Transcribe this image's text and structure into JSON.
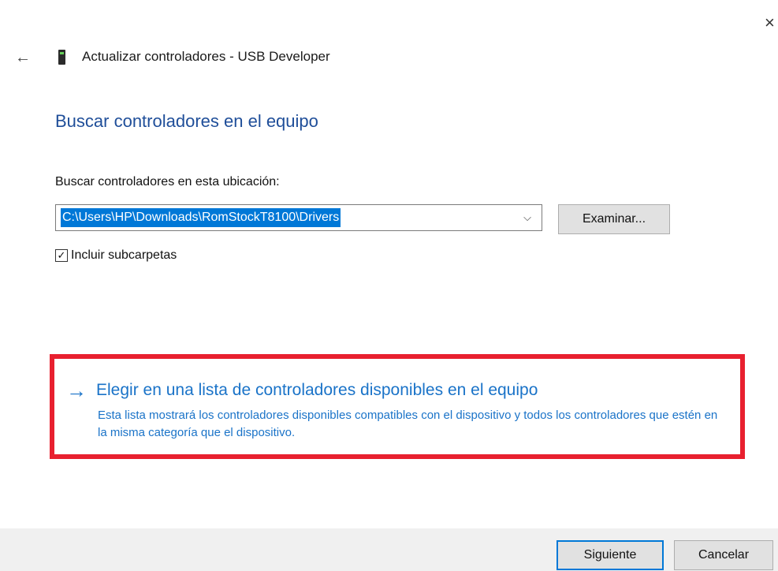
{
  "window": {
    "title": "Actualizar controladores - USB Developer",
    "close_glyph": "×",
    "back_glyph": "←",
    "device_icon": "usb-device-icon"
  },
  "main": {
    "heading": "Buscar controladores en el equipo",
    "location_label": "Buscar controladores en esta ubicación:",
    "path_value": "C:\\Users\\HP\\Downloads\\RomStockT8100\\Drivers",
    "browse_label": "Examinar...",
    "include_subfolders_label": "Incluir subcarpetas",
    "include_subfolders_checked": true
  },
  "choose_option": {
    "title": "Elegir en una lista de controladores disponibles en el equipo",
    "description": "Esta lista mostrará los controladores disponibles compatibles con el dispositivo y todos los controladores que estén en la misma categoría que el dispositivo.",
    "highlight_color": "#e8202f"
  },
  "footer": {
    "next_label": "Siguiente",
    "cancel_label": "Cancelar"
  },
  "colors": {
    "accent": "#0078d7",
    "heading": "#1f4e99",
    "link": "#1a73c8"
  }
}
